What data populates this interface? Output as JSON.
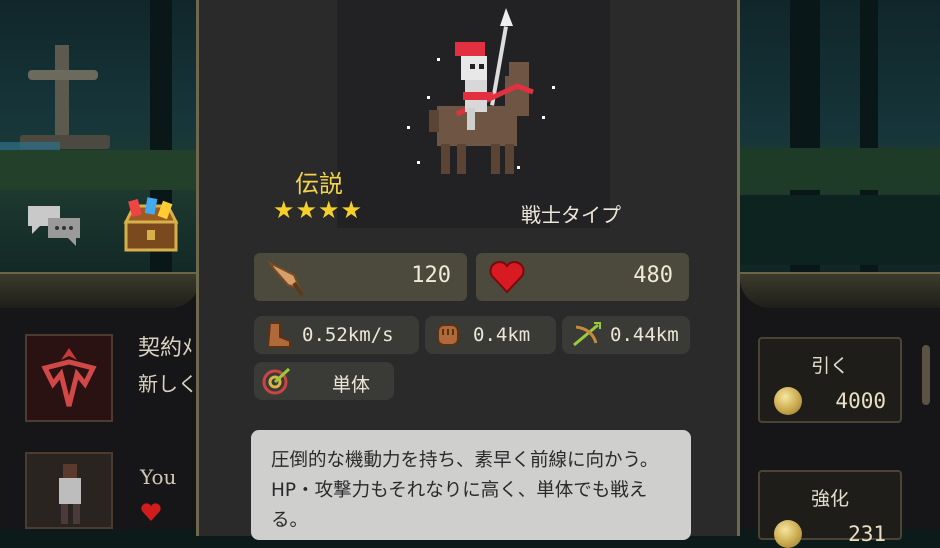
{
  "unit": {
    "rarity": "伝説",
    "stars": 4,
    "type": "戦士タイプ",
    "attack": "120",
    "hp": "480",
    "speed": "0.52km/s",
    "melee_range": "0.4km",
    "attack_range": "0.44km",
    "target": "単体",
    "description": "圧倒的な機動力を持ち、素早く前線に向かう。HP・攻撃力もそれなりに高く、単体でも戦える。"
  },
  "left_panel": {
    "contract_title": "契約ﾒ",
    "contract_subtitle": "新しく",
    "player_label": "You"
  },
  "right_panel": {
    "pull": {
      "label": "引く",
      "price": "4000"
    },
    "upgrade": {
      "label": "強化",
      "price": "231"
    }
  },
  "icons": [
    "chat-icon",
    "treasure-chest-icon",
    "contract-emblem-icon",
    "sword-icon",
    "heart-icon",
    "boot-icon",
    "fist-icon",
    "crossbow-icon",
    "target-icon",
    "coin-icon"
  ],
  "colors": {
    "rarity": "#f3d44a",
    "star": "#f6cf2b",
    "stat_bg": "#4c4a3d",
    "desc_bg": "#cfcfcd"
  }
}
